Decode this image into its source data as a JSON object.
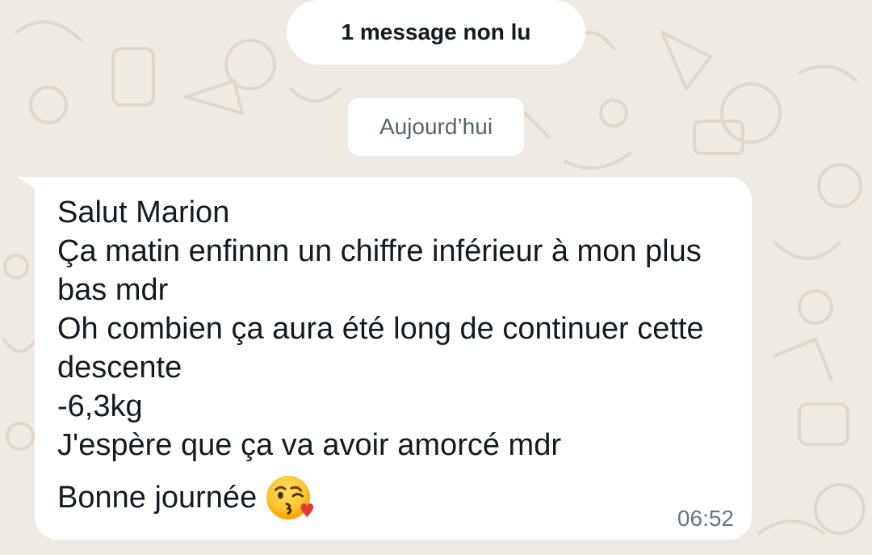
{
  "banner": {
    "unread_label": "1 message non lu"
  },
  "date_chip": {
    "label": "Aujourd’hui"
  },
  "message": {
    "lines": [
      "Salut Marion",
      "Ça matin enfinnn un chiffre inférieur à mon plus bas mdr",
      "Oh combien ça aura été long de continuer cette descente",
      "-6,3kg",
      "J'espère que ça va avoir amorcé mdr",
      "Bonne journée"
    ],
    "emoji_icon": "face-blowing-a-kiss-icon",
    "time": "06:52"
  },
  "colors": {
    "wallpaper": "#efeae2",
    "bubble": "#ffffff",
    "text": "#111b21",
    "meta_text": "#667781"
  }
}
